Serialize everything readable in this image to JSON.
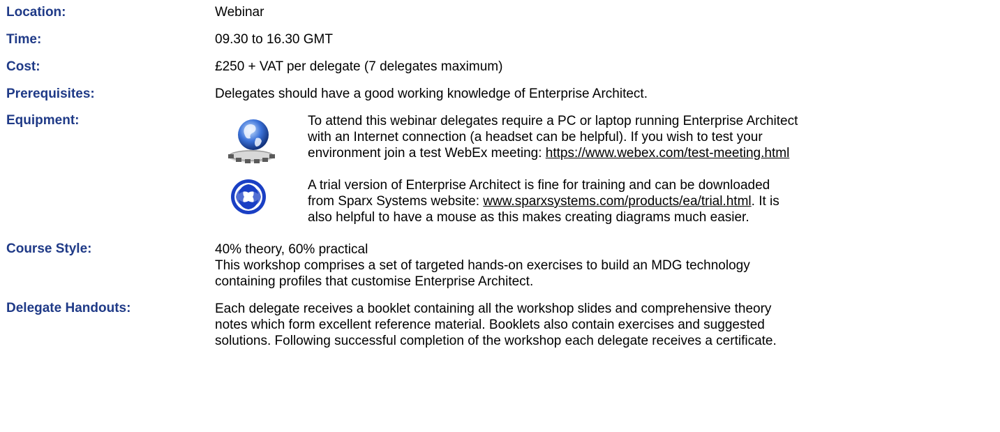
{
  "location": {
    "label": "Location:",
    "value": "Webinar"
  },
  "time": {
    "label": "Time:",
    "value": "09.30 to 16.30 GMT"
  },
  "cost": {
    "label": "Cost:",
    "value": "£250 + VAT per delegate (7 delegates maximum)"
  },
  "prerequisites": {
    "label": "Prerequisites:",
    "value": "Delegates should have a good working knowledge of Enterprise Architect."
  },
  "equipment": {
    "label": "Equipment:",
    "webinar": {
      "icon": "globe-network-icon",
      "line1": "To attend this webinar delegates require a PC or laptop running Enterprise Architect",
      "line2": "with an Internet connection (a headset can be helpful). If you wish to test your",
      "line3_prefix": "environment join a test WebEx meeting: ",
      "link": "https://www.webex.com/test-meeting.html"
    },
    "trial": {
      "icon": "sparx-logo-icon",
      "line1": "A trial version of Enterprise Architect is fine for training and can be downloaded",
      "line2_prefix": "from Sparx Systems website: ",
      "link": "www.sparxsystems.com/products/ea/trial.html",
      "line2_suffix": ". It is",
      "line3": "also helpful to have a mouse as this makes creating diagrams much easier."
    }
  },
  "course_style": {
    "label": "Course Style:",
    "line1": "40% theory, 60% practical",
    "line2": "This workshop comprises a set of targeted hands-on exercises to build an MDG technology",
    "line3": "containing profiles that customise Enterprise Architect."
  },
  "delegate_handouts": {
    "label": "Delegate Handouts:",
    "line1": "Each delegate receives a booklet containing all the workshop slides and comprehensive theory",
    "line2": "notes which form excellent reference material. Booklets also contain exercises and suggested",
    "line3": "solutions. Following successful completion of the workshop each delegate receives a certificate."
  },
  "colors": {
    "label": "#1f3a87",
    "text": "#000000",
    "icon_blue": "#1a3fc4"
  }
}
